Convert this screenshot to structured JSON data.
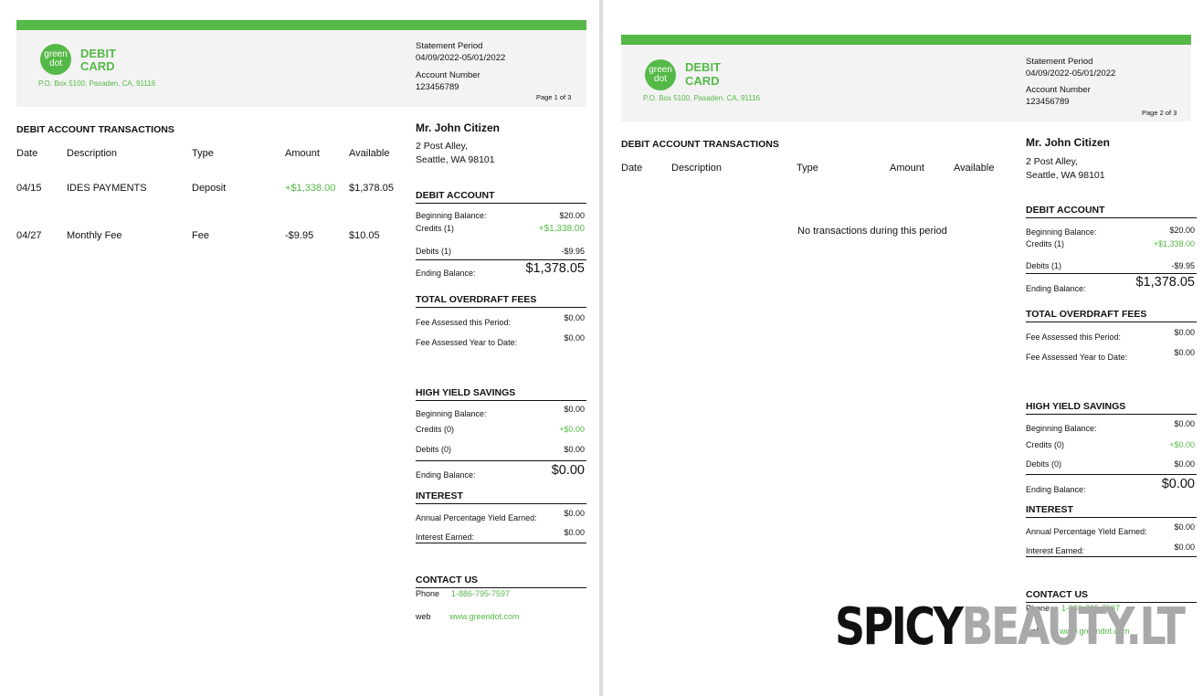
{
  "brand": {
    "logo_line1": "green",
    "logo_line2": "dot",
    "word1": "DEBIT",
    "word2": "CARD",
    "address": "P.O. Box 5100, Pasaden. CA, 91116",
    "color": "#55b947"
  },
  "statement": {
    "period_label": "Statement Period",
    "period_value": "04/09/2022-05/01/2022",
    "account_label": "Account Number",
    "account_value": "123456789"
  },
  "customer": {
    "name": "Mr. John Citizen",
    "address_line1": "2 Post Alley,",
    "address_line2": "Seattle, WA 98101"
  },
  "transactions": {
    "title": "DEBIT ACCOUNT TRANSACTIONS",
    "columns": [
      "Date",
      "Description",
      "Type",
      "Amount",
      "Available"
    ],
    "rows": [
      {
        "date": "04/15",
        "description": "IDES PAYMENTS",
        "type": "Deposit",
        "amount": "+$1,338.00",
        "available": "$1,378.05"
      },
      {
        "date": "04/27",
        "description": "Monthly Fee",
        "type": "Fee",
        "amount": "-$9.95",
        "available": "$10.05"
      }
    ],
    "empty_message": "No transactions during this period"
  },
  "debit_account": {
    "title": "DEBIT ACCOUNT",
    "beginning_label": "Beginning Balance:",
    "beginning_value": "$20.00",
    "credits_label": "Credits (1)",
    "credits_value": "+$1,338.00",
    "debits_label": "Debits (1)",
    "debits_value": "-$9.95",
    "ending_label": "Ending Balance:",
    "ending_value": "$1,378.05"
  },
  "overdraft": {
    "title": "TOTAL OVERDRAFT FEES",
    "period_label": "Fee Assessed this Period:",
    "period_value": "$0.00",
    "ytd_label": "Fee Assessed Year to Date:",
    "ytd_value": "$0.00"
  },
  "savings": {
    "title": "HIGH YIELD SAVINGS",
    "beginning_label": "Beginning Balance:",
    "beginning_value": "$0.00",
    "credits_label": "Credits (0)",
    "credits_value": "+$0.00",
    "debits_label": "Debits (0)",
    "debits_value": "$0.00",
    "ending_label": "Ending Balance:",
    "ending_value": "$0.00"
  },
  "interest": {
    "title": "INTEREST",
    "apy_label": "Annual Percentage Yield Earned:",
    "apy_value": "$0.00",
    "earned_label": "Interest Earned:",
    "earned_value": "$0.00"
  },
  "contact": {
    "title": "CONTACT US",
    "phone_label": "Phone",
    "phone_value": "1-886-795-7597",
    "web_label": "web",
    "web_value": "www.greendot.com"
  },
  "pages": [
    {
      "page_label": "Page 1 of 3"
    },
    {
      "page_label": "Page 2 of 3"
    }
  ],
  "watermark": {
    "part1": "SPICY",
    "part2": "BEAUTY.LT"
  }
}
